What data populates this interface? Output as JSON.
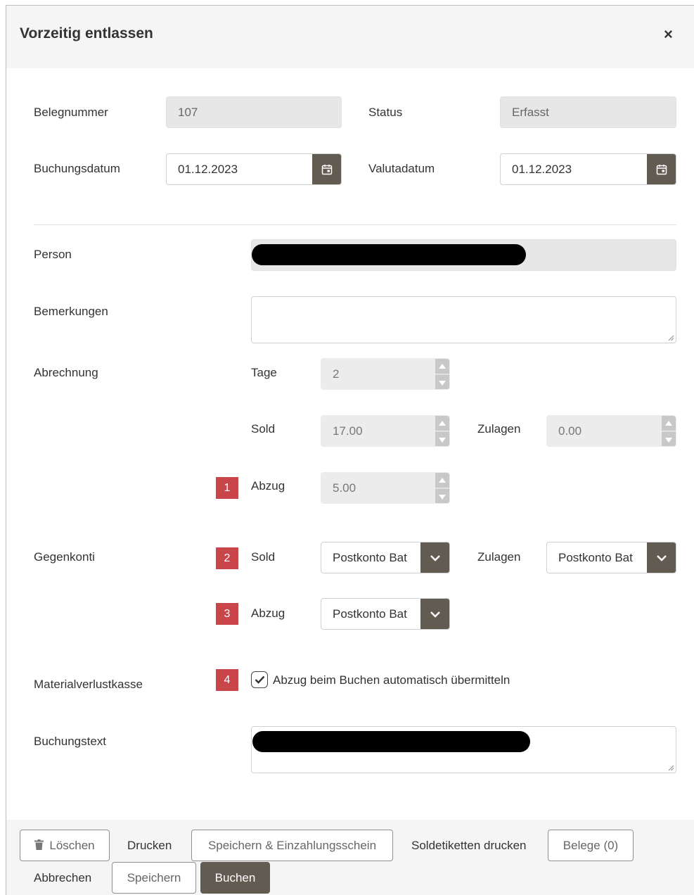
{
  "dialog": {
    "title": "Vorzeitig entlassen",
    "close_glyph": "×"
  },
  "form": {
    "belegnummer": {
      "label": "Belegnummer",
      "value": "107"
    },
    "status": {
      "label": "Status",
      "value": "Erfasst"
    },
    "buchungsdatum": {
      "label": "Buchungsdatum",
      "value": "01.12.2023"
    },
    "valutadatum": {
      "label": "Valutadatum",
      "value": "01.12.2023"
    },
    "person": {
      "label": "Person",
      "value_redacted": true
    },
    "bemerkungen": {
      "label": "Bemerkungen",
      "value": ""
    },
    "abrechnung": {
      "label": "Abrechnung",
      "tage": {
        "label": "Tage",
        "value": "2"
      },
      "sold": {
        "label": "Sold",
        "value": "17.00"
      },
      "zulagen": {
        "label": "Zulagen",
        "value": "0.00"
      },
      "abzug": {
        "label": "Abzug",
        "value": "5.00"
      }
    },
    "gegenkonti": {
      "label": "Gegenkonti",
      "sold": {
        "label": "Sold",
        "value": "Postkonto Bat"
      },
      "zulagen": {
        "label": "Zulagen",
        "value": "Postkonto Bat"
      },
      "abzug": {
        "label": "Abzug",
        "value": "Postkonto Bat"
      }
    },
    "materialverlustkasse": {
      "label": "Materialverlustkasse",
      "checkbox_label": "Abzug beim Buchen automatisch übermitteln",
      "checked": true
    },
    "buchungstext": {
      "label": "Buchungstext",
      "value_redacted": true
    }
  },
  "badges": [
    "1",
    "2",
    "3",
    "4"
  ],
  "footer": {
    "loeschen": "Löschen",
    "drucken": "Drucken",
    "speichern_einzahlungsschein": "Speichern & Einzahlungsschein",
    "soldetiketten": "Soldetiketten drucken",
    "belege": "Belege (0)",
    "abbrechen": "Abbrechen",
    "speichern": "Speichern",
    "buchen": "Buchen"
  },
  "colors": {
    "accent": "#625b52",
    "badge": "#c9454a",
    "header_bg": "#f5f5f5",
    "readonly_bg": "#e7e7e7"
  },
  "icons": [
    "close-icon",
    "calendar-icon",
    "spinner-up-icon",
    "spinner-down-icon",
    "chevron-down-icon",
    "check-icon",
    "trash-icon",
    "resize-handle-icon"
  ]
}
